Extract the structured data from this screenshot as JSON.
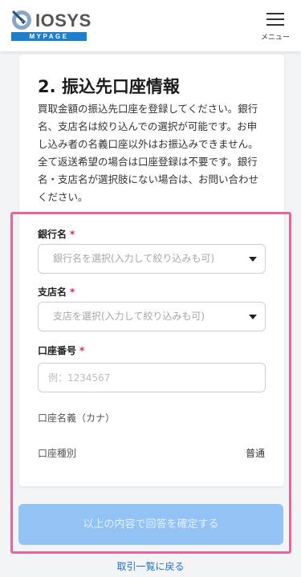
{
  "header": {
    "logo_text": "IOSYS",
    "logo_sub": "MYPAGE",
    "menu_label": "メニュー"
  },
  "section": {
    "title": "2. 振込先口座情報",
    "description": "買取金額の振込先口座を登録してください。銀行\n名、支店名は絞り込んでの選択が可能です。お申\nし込み者の名義口座以外はお振込みできません。\n全て返送希望の場合は口座登録は不要です。銀行\n名・支店名が選択肢にない場合は、お問い合わせ\nください。"
  },
  "form": {
    "bank": {
      "label": "銀行名",
      "required_mark": "*",
      "placeholder": "銀行名を選択(入力して絞り込みも可)"
    },
    "branch": {
      "label": "支店名",
      "required_mark": "*",
      "placeholder": "支店を選択(入力して絞り込みも可)"
    },
    "account_number": {
      "label": "口座番号",
      "required_mark": "*",
      "placeholder": "例：1234567",
      "value": ""
    },
    "account_name": {
      "label": "口座名義（カナ）"
    },
    "account_type": {
      "label": "口座種別",
      "value": "普通"
    }
  },
  "actions": {
    "submit_label": "以上の内容で回答を確定する",
    "back_label": "取引一覧に戻る"
  },
  "colors": {
    "highlight": "#e5669b",
    "submit_bg": "#93c2f5",
    "link": "#1d6fd0",
    "brand": "#1f7fcf"
  }
}
